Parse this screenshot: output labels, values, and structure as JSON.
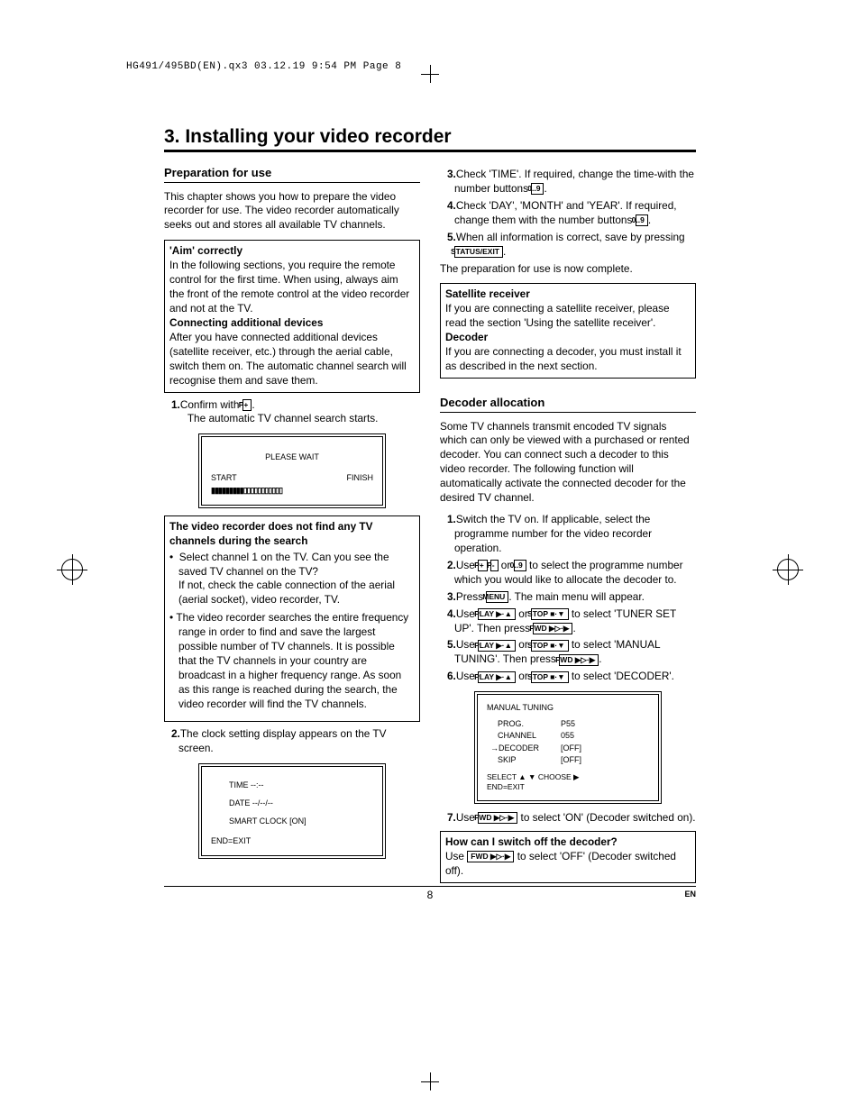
{
  "header": "HG491/495BD(EN).qx3  03.12.19  9:54 PM  Page 8",
  "title": "3. Installing your video recorder",
  "left": {
    "sec1_title": "Preparation for use",
    "intro": "This chapter shows you how to prepare the video recorder for use. The video recorder automatically seeks out and stores all available TV channels.",
    "box1_h1": "'Aim' correctly",
    "box1_p1": "In the following sections, you require the remote control for the first time. When using, always aim the front of the remote control at the video recorder and not at the TV.",
    "box1_h2": "Connecting additional devices",
    "box1_p2": "After you have connected additional devices (satellite receiver, etc.) through the aerial cable, switch them on. The automatic channel search will recognise them and save them.",
    "step1a": "Confirm with ",
    "step1b": ".",
    "step1c": "The automatic TV channel search starts.",
    "screen1_wait": "PLEASE WAIT",
    "screen1_start": "START",
    "screen1_finish": "FINISH",
    "screen1_bar": "▮▮▮▮▮▮▮▮▮▯▯▯▯▯▯▯▯▯▯▯",
    "box2_h": "The video recorder does not find any TV channels during the search",
    "box2_b1a": "Select channel 1 on the TV. Can you see the saved TV channel on the TV?",
    "box2_b1b": "If not, check the cable connection of the aerial (aerial socket), video recorder, TV.",
    "box2_b2": "The video recorder searches the entire frequency range in order to find and save the largest possible number of TV channels. It is possible that the TV channels in your country are broadcast in a higher frequency range. As soon as this range is reached during the search, the video recorder will find the TV channels.",
    "step2": "The clock setting display appears on the TV screen.",
    "screen2_time": "TIME --:--",
    "screen2_date": "DATE --/--/--",
    "screen2_smart": "SMART CLOCK [ON]",
    "screen2_end": "END=EXIT"
  },
  "right": {
    "step3a": "Check 'TIME'. If required, change the time-with the number buttons ",
    "step3b": ".",
    "step4a": "Check 'DAY', 'MONTH' and 'YEAR'. If required, change them with the number buttons ",
    "step4b": ".",
    "step5a": "When all information is correct, save by pressing ",
    "step5b": ".",
    "prep_done": "The preparation for use is now complete.",
    "box3_h1": "Satellite receiver",
    "box3_p1": "If you are connecting a satellite receiver, please read the section 'Using the satellite receiver'.",
    "box3_h2": "Decoder",
    "box3_p2": "If you are connecting a decoder, you must install it as described in the next section.",
    "sec2_title": "Decoder allocation",
    "sec2_intro": "Some TV channels transmit encoded TV signals which can only be viewed with a purchased or rented decoder. You can connect such a decoder to this video recorder. The following function will automatically activate the connected decoder for the desired TV channel.",
    "d1": "Switch the TV on. If applicable, select the programme number for the video recorder operation.",
    "d2a": "Use ",
    "d2b": " or ",
    "d2c": " to select the programme number which you would like to allocate the decoder to.",
    "d3a": "Press ",
    "d3b": ". The main menu will appear.",
    "d4a": "Use ",
    "d4b": " or ",
    "d4c": " to select 'TUNER SET UP'. Then press ",
    "d4d": ".",
    "d5a": "Use ",
    "d5b": " or ",
    "d5c": " to select 'MANUAL TUNING'. Then press ",
    "d5d": ".",
    "d6a": "Use ",
    "d6b": " or ",
    "d6c": " to select 'DECODER'.",
    "tuning_title": "MANUAL TUNING",
    "t_prog_l": "PROG.",
    "t_prog_v": "P55",
    "t_ch_l": "CHANNEL",
    "t_ch_v": "055",
    "t_dec_l": "DECODER",
    "t_dec_v": "[OFF]",
    "t_skip_l": "SKIP",
    "t_skip_v": "[OFF]",
    "t_sel": "SELECT ▲ ▼  CHOOSE ▶",
    "t_end": "END=EXIT",
    "d7a": "Use ",
    "d7b": " to select 'ON' (Decoder switched on).",
    "box4_h": "How can I switch off the decoder?",
    "box4_a": "Use ",
    "box4_b": " to select 'OFF' (Decoder switched off)."
  },
  "keys": {
    "pplus": "P+",
    "pminus": "P-",
    "num": "0..9",
    "status": "STATUS/EXIT",
    "menu": "MENU",
    "play": "PLAY ▶·▲",
    "stop": "STOP ■·▼",
    "fwd": "FWD ▶▷·▶"
  },
  "page_number": "8",
  "lang": "EN"
}
